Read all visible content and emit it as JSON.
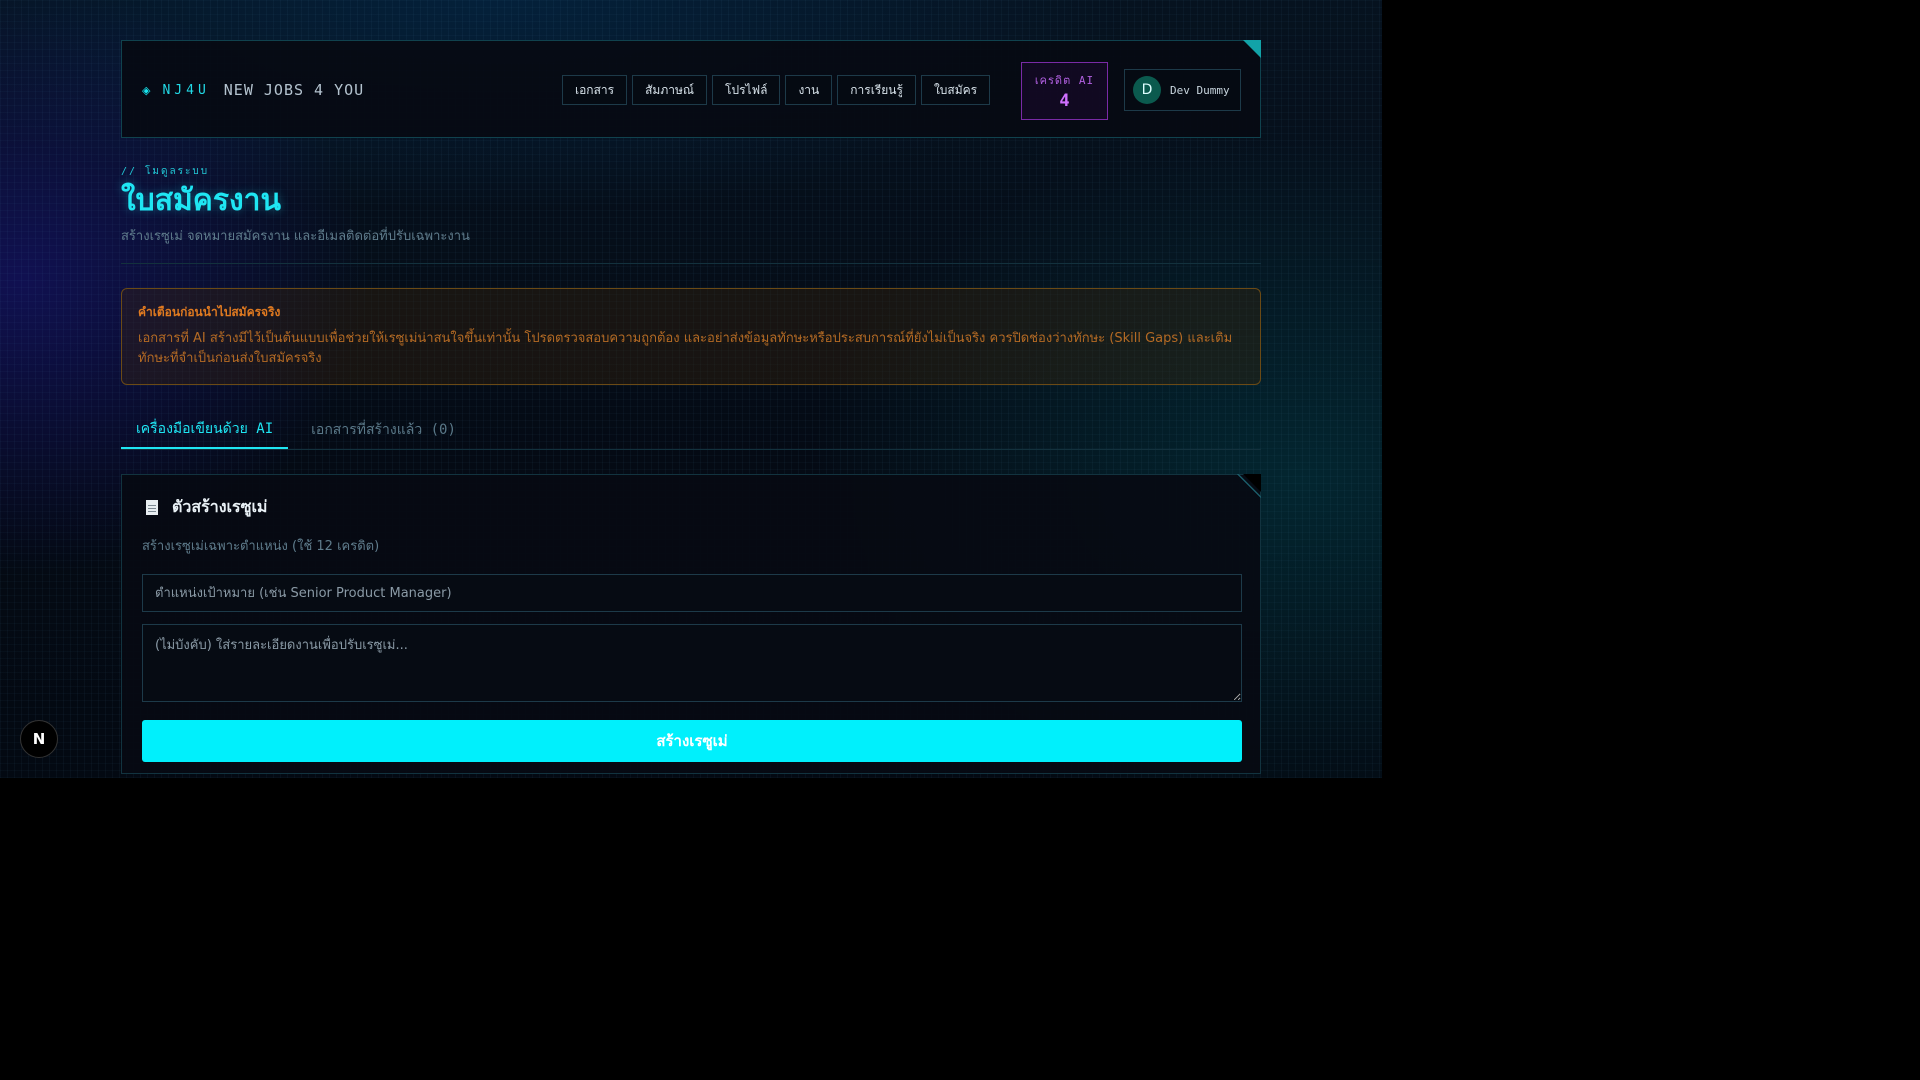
{
  "brand": {
    "code": "NJ4U",
    "name": "NEW JOBS 4 YOU",
    "icon": "diamond-icon"
  },
  "nav": [
    {
      "label": "เอกสาร"
    },
    {
      "label": "สัมภาษณ์"
    },
    {
      "label": "โปรไฟล์"
    },
    {
      "label": "งาน"
    },
    {
      "label": "การเรียนรู้"
    },
    {
      "label": "ใบสมัคร"
    }
  ],
  "credits": {
    "label": "เครดิต AI",
    "value": "4"
  },
  "user": {
    "initial": "D",
    "name": "Dev Dummy"
  },
  "page": {
    "eyebrow": "// โมดูลระบบ",
    "title": "ใบสมัครงาน",
    "subtitle": "สร้างเรซูเม่ จดหมายสมัครงาน และอีเมลติดต่อที่ปรับเฉพาะงาน"
  },
  "warning": {
    "title": "คำเตือนก่อนนำไปสมัครจริง",
    "body": "เอกสารที่ AI สร้างมีไว้เป็นต้นแบบเพื่อช่วยให้เรซูเม่น่าสนใจขึ้นเท่านั้น โปรดตรวจสอบความถูกต้อง และอย่าส่งข้อมูลทักษะหรือประสบการณ์ที่ยังไม่เป็นจริง ควรปิดช่องว่างทักษะ (Skill Gaps) และเติมทักษะที่จำเป็นก่อนส่งใบสมัครจริง"
  },
  "tabs": [
    {
      "label": "เครื่องมือเขียนด้วย AI",
      "active": true
    },
    {
      "label": "เอกสารที่สร้างแล้ว (0)",
      "active": false
    }
  ],
  "card": {
    "title": "ตัวสร้างเรซูเม่",
    "description": "สร้างเรซูเม่เฉพาะตำแหน่ง (ใช้ 12 เครดิต)",
    "position_placeholder": "ตำแหน่งเป้าหมาย (เช่น Senior Product Manager)",
    "job_placeholder": "(ไม่บังคับ) ใส่รายละเอียดงานเพื่อปรับเรซูเม่...",
    "submit_label": "สร้างเรซูเม่"
  },
  "badge": {
    "label": "N"
  },
  "colors": {
    "accent": "#1fe6f3",
    "credits": "#d070ff",
    "warning": "#e07a20",
    "button": "#00f0fc"
  }
}
